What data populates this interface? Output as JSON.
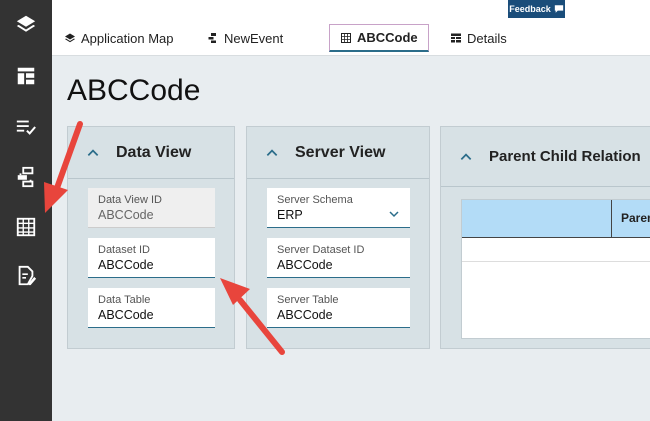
{
  "sidebar": {
    "icons": [
      "layers-icon",
      "layout-icon",
      "checklist-icon",
      "flow-icon",
      "grid-icon",
      "edit-doc-icon"
    ]
  },
  "tabs": [
    {
      "label": "Application Map",
      "icon": "layers-icon"
    },
    {
      "label": "NewEvent",
      "icon": "flow-icon"
    },
    {
      "label": "ABCCode",
      "icon": "grid-icon",
      "active": true
    },
    {
      "label": "Details",
      "icon": "table-icon"
    }
  ],
  "feedback": {
    "label": "Feedback"
  },
  "page": {
    "title": "ABCCode"
  },
  "data_view": {
    "title": "Data View",
    "fields": [
      {
        "label": "Data View ID",
        "value": "ABCCode",
        "readonly": true
      },
      {
        "label": "Dataset ID",
        "value": "ABCCode"
      },
      {
        "label": "Data Table",
        "value": "ABCCode"
      }
    ]
  },
  "server_view": {
    "title": "Server View",
    "fields": [
      {
        "label": "Server Schema",
        "value": "ERP"
      },
      {
        "label": "Server Dataset ID",
        "value": "ABCCode"
      },
      {
        "label": "Server Table",
        "value": "ABCCode"
      }
    ]
  },
  "parent_child": {
    "title": "Parent Child Relation",
    "grid_header": "Paren"
  },
  "colors": {
    "sidebar": "#333333",
    "accent": "#2b6d8a",
    "panel": "#d7e1e5",
    "grid_header": "#b3dcf7",
    "arrow": "#e8453c",
    "feedback": "#1a4d7a"
  }
}
